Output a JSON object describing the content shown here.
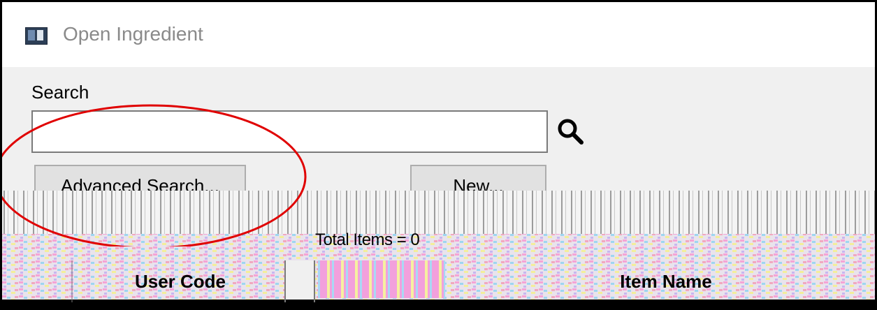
{
  "window": {
    "title": "Open Ingredient",
    "icon": "window-app-icon"
  },
  "search": {
    "label": "Search",
    "value": "",
    "placeholder": "",
    "icon": "search-icon"
  },
  "buttons": {
    "advanced_search": "Advanced Search...",
    "new": "New..."
  },
  "results": {
    "total_items": "Total Items = 0",
    "columns": [
      "User Code",
      "Item Name"
    ]
  },
  "colors": {
    "title_text": "#8a8a8a",
    "dialog_bg": "#f0f0f0",
    "highlight_ellipse": "#e00000"
  }
}
